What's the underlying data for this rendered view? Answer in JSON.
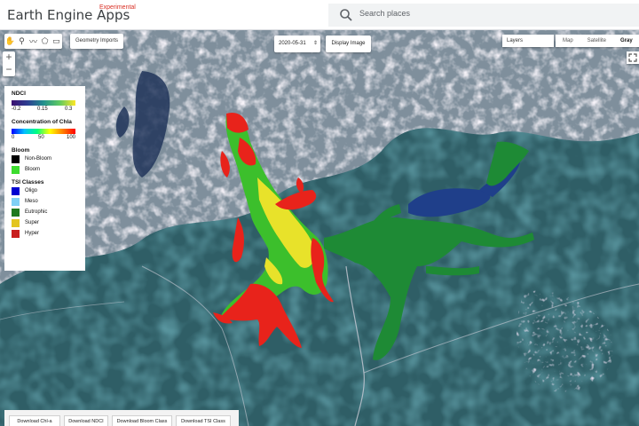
{
  "header": {
    "app_title": "Earth Engine Apps",
    "app_badge": "Experimental",
    "search_placeholder": "Search places"
  },
  "toolbar": {
    "icons": [
      "hand-icon",
      "marker-icon",
      "polyline-icon",
      "polygon-icon",
      "rectangle-icon"
    ],
    "geometry_imports_label": "Geometry Imports",
    "zoom_in_label": "+",
    "zoom_out_label": "−"
  },
  "controls": {
    "date_value": "2020-05-31",
    "display_image_label": "Display Image",
    "layers_label": "Layers",
    "map_types": [
      {
        "label": "Map",
        "active": false
      },
      {
        "label": "Satellite",
        "active": false
      },
      {
        "label": "Gray",
        "active": true
      }
    ]
  },
  "legend": {
    "ndci": {
      "title": "NDCI",
      "ticks": [
        "-0.2",
        "0.15",
        "0.3"
      ]
    },
    "chla": {
      "title": "Concentration of Chla",
      "ticks": [
        "0",
        "50",
        "100"
      ]
    },
    "bloom": {
      "title": "Bloom",
      "items": [
        {
          "label": "Non-Bloom",
          "color": "#000000"
        },
        {
          "label": "Bloom",
          "color": "#3ddc2f"
        }
      ]
    },
    "tsi": {
      "title": "TSI Classes",
      "items": [
        {
          "label": "Oligo",
          "color": "#0000d0"
        },
        {
          "label": "Meso",
          "color": "#7fd0f5"
        },
        {
          "label": "Eutrophic",
          "color": "#1f7a1f"
        },
        {
          "label": "Super",
          "color": "#e3c520"
        },
        {
          "label": "Hyper",
          "color": "#c81e1e"
        }
      ]
    }
  },
  "downloads": [
    {
      "label": "Download Chl-a"
    },
    {
      "label": "Download NDCI"
    },
    {
      "label": "Download Bloom Class"
    },
    {
      "label": "Download TSI Class"
    }
  ]
}
